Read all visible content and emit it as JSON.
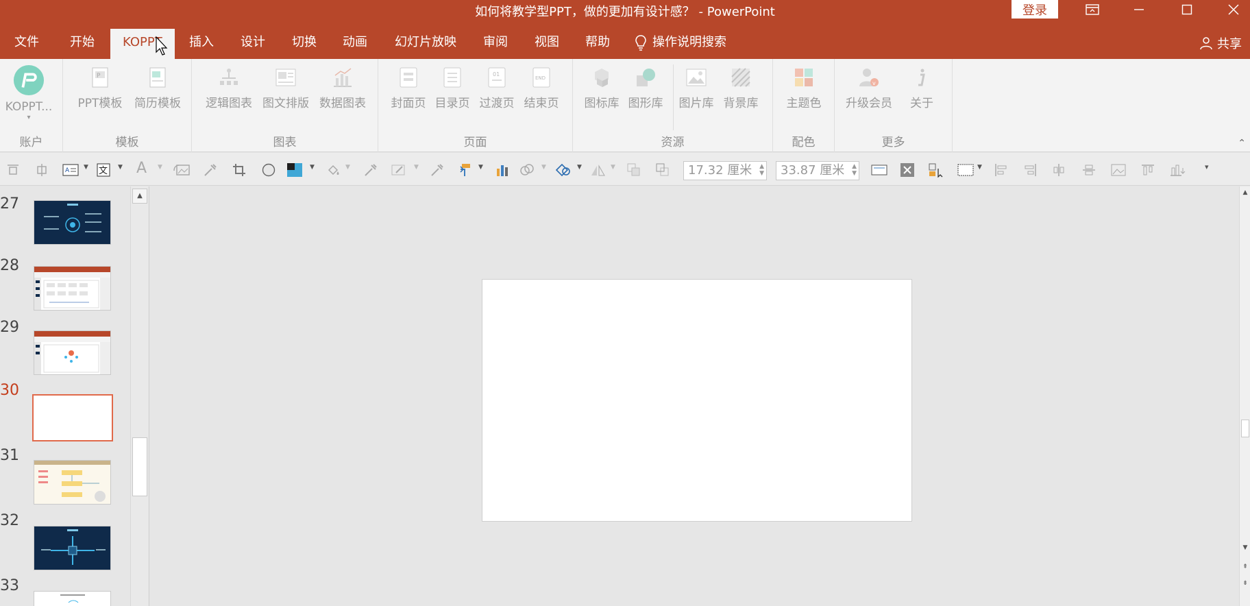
{
  "window": {
    "title": "如何将教学型PPT，做的更加有设计感？  -  PowerPoint",
    "login_label": "登录"
  },
  "menu": {
    "tabs": [
      {
        "label": "文件"
      },
      {
        "label": "开始"
      },
      {
        "label": "KOPPT"
      },
      {
        "label": "插入"
      },
      {
        "label": "设计"
      },
      {
        "label": "切换"
      },
      {
        "label": "动画"
      },
      {
        "label": "幻灯片放映"
      },
      {
        "label": "审阅"
      },
      {
        "label": "视图"
      },
      {
        "label": "帮助"
      },
      {
        "label": "操作说明搜索"
      }
    ],
    "active": "KOPPT",
    "share_label": "共享"
  },
  "ribbon": {
    "groups": [
      {
        "label": "账户",
        "buttons": [
          {
            "label": "KOPPT...",
            "icon": "koppt-logo-icon"
          }
        ]
      },
      {
        "label": "模板",
        "buttons": [
          {
            "label": "PPT模板",
            "icon": "ppt-template-icon"
          },
          {
            "label": "简历模板",
            "icon": "resume-template-icon"
          }
        ]
      },
      {
        "label": "图表",
        "buttons": [
          {
            "label": "逻辑图表",
            "icon": "logic-chart-icon"
          },
          {
            "label": "图文排版",
            "icon": "image-text-layout-icon"
          },
          {
            "label": "数据图表",
            "icon": "data-chart-icon"
          }
        ]
      },
      {
        "label": "页面",
        "buttons": [
          {
            "label": "封面页",
            "icon": "cover-page-icon"
          },
          {
            "label": "目录页",
            "icon": "toc-page-icon"
          },
          {
            "label": "过渡页",
            "icon": "transition-page-icon"
          },
          {
            "label": "结束页",
            "icon": "end-page-icon"
          }
        ]
      },
      {
        "label": "资源",
        "buttons": [
          {
            "label": "图标库",
            "icon": "icon-library-icon"
          },
          {
            "label": "图形库",
            "icon": "shape-library-icon"
          },
          {
            "label": "图片库",
            "icon": "picture-library-icon"
          },
          {
            "label": "背景库",
            "icon": "background-library-icon"
          }
        ]
      },
      {
        "label": "配色",
        "buttons": [
          {
            "label": "主题色",
            "icon": "theme-color-icon"
          }
        ]
      },
      {
        "label": "更多",
        "buttons": [
          {
            "label": "升级会员",
            "icon": "upgrade-member-icon"
          },
          {
            "label": "关于",
            "icon": "about-icon"
          }
        ]
      }
    ]
  },
  "toolbar": {
    "height_value": "17.32 厘米",
    "width_value": "33.87 厘米"
  },
  "slides": {
    "items": [
      {
        "number": "27",
        "style": "dark"
      },
      {
        "number": "28",
        "style": "screenshot"
      },
      {
        "number": "29",
        "style": "screenshot"
      },
      {
        "number": "30",
        "style": "blank"
      },
      {
        "number": "31",
        "style": "light"
      },
      {
        "number": "32",
        "style": "dark"
      },
      {
        "number": "33",
        "style": "light"
      }
    ],
    "selected": "30"
  },
  "colors": {
    "accent": "#b7472a",
    "selected_slide_border": "#e0694a",
    "selected_number": "#c43e1c"
  }
}
